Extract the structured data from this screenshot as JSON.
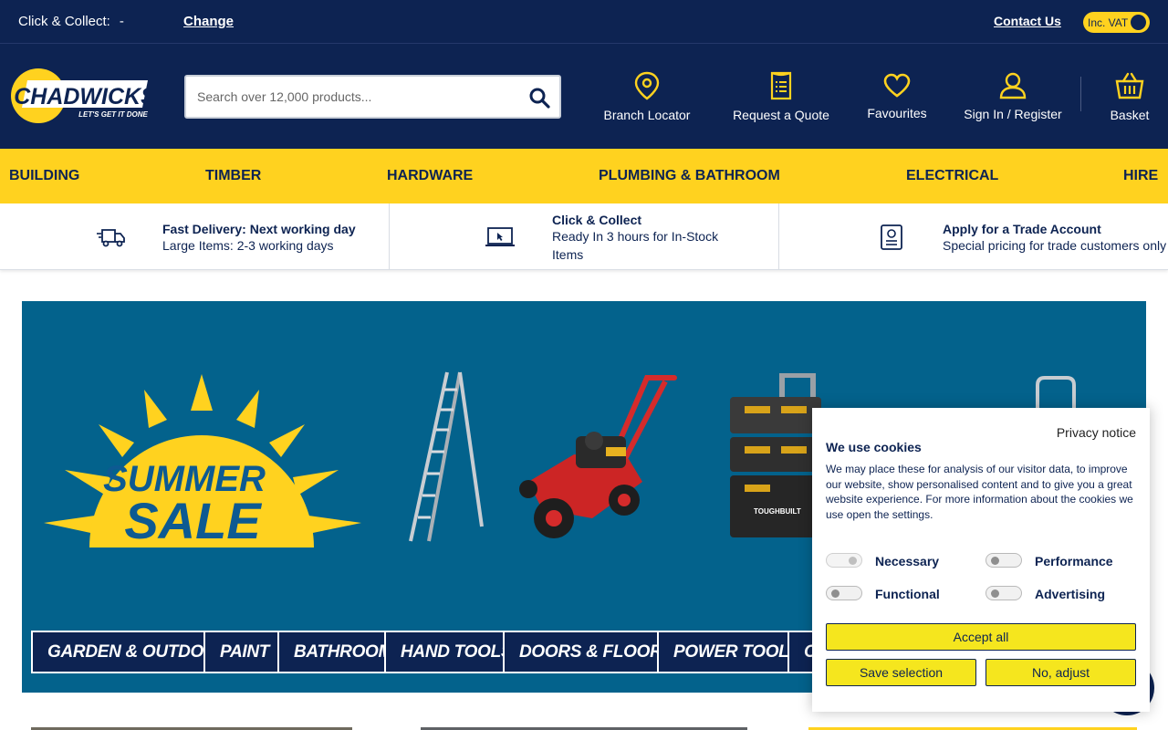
{
  "topbar": {
    "click_collect_label": "Click & Collect:",
    "click_collect_value": "-",
    "change_label": "Change",
    "contact_label": "Contact Us",
    "vat_label": "Inc. VAT"
  },
  "header": {
    "logo_text": "CHADWICKS",
    "logo_tagline": "LET'S GET IT DONE",
    "search_placeholder": "Search over 12,000 products...",
    "nav": [
      {
        "label": "Branch Locator",
        "icon": "map-pin-icon"
      },
      {
        "label": "Request a Quote",
        "icon": "document-list-icon"
      },
      {
        "label": "Favourites",
        "icon": "heart-icon"
      },
      {
        "label": "Sign In / Register",
        "icon": "user-icon"
      },
      {
        "label": "Basket",
        "icon": "basket-icon"
      }
    ]
  },
  "categories": [
    "BUILDING",
    "TIMBER",
    "HARDWARE",
    "PLUMBING & BATHROOM",
    "ELECTRICAL",
    "HIRE"
  ],
  "usp": [
    {
      "title": "Fast Delivery: Next working day",
      "sub": "Large Items: 2-3 working days",
      "icon": "delivery-truck-icon"
    },
    {
      "title": "Click & Collect",
      "sub": "Ready In 3 hours for In-Stock Items",
      "icon": "laptop-cursor-icon"
    },
    {
      "title": "Apply for a Trade Account",
      "sub": "Special pricing for trade customers only",
      "icon": "trade-account-icon"
    }
  ],
  "hero": {
    "headline_1": "SUMMER",
    "headline_2": "SALE",
    "product_brand": "TOUGHBUILT",
    "buttons": [
      "GARDEN & OUTDOOR",
      "PAINT",
      "BATHROOM",
      "HAND TOOLS",
      "DOORS & FLOORS",
      "POWER TOOLS",
      "O"
    ]
  },
  "cookie": {
    "privacy_link": "Privacy notice",
    "title": "We use cookies",
    "text": "We may place these for analysis of our visitor data, to improve our website, show personalised content and to give you a great website experience. For more information about the cookies we use open the settings.",
    "options": [
      {
        "label": "Necessary",
        "state": "on"
      },
      {
        "label": "Performance",
        "state": "off"
      },
      {
        "label": "Functional",
        "state": "off"
      },
      {
        "label": "Advertising",
        "state": "off"
      }
    ],
    "accept_all": "Accept all",
    "save_selection": "Save selection",
    "no_adjust": "No, adjust"
  },
  "colors": {
    "navy": "#0d2352",
    "yellow": "#ffd21f",
    "hero_blue": "#03628c",
    "cookie_button": "#f5e61e"
  }
}
